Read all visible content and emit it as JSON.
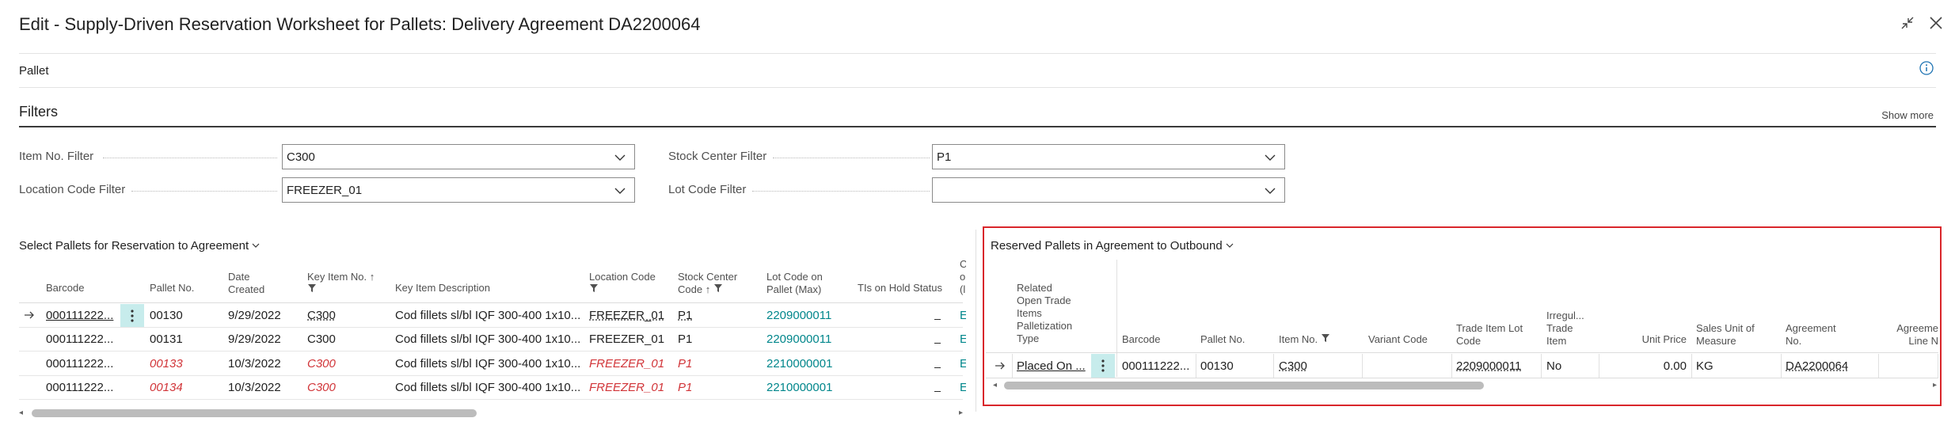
{
  "window": {
    "title": "Edit - Supply-Driven Reservation Worksheet for Pallets: Delivery Agreement DA2200064"
  },
  "page": {
    "subtitle": "Pallet"
  },
  "filters": {
    "title": "Filters",
    "show_more": "Show more",
    "item_no": {
      "label": "Item No. Filter",
      "value": "C300"
    },
    "location_code": {
      "label": "Location Code Filter",
      "value": "FREEZER_01"
    },
    "stock_center": {
      "label": "Stock Center Filter",
      "value": "P1"
    },
    "lot_code": {
      "label": "Lot Code Filter",
      "value": ""
    }
  },
  "select_part": {
    "title": "Select Pallets for Reservation to Agreement",
    "headers": {
      "barcode": "Barcode",
      "pallet_no": "Pallet No.",
      "date_created_1": "Date",
      "date_created_2": "Created",
      "key_item_no": "Key Item No.",
      "key_item_desc": "Key Item Description",
      "location_code": "Location Code",
      "stock_center_1": "Stock Center",
      "stock_center_2": "Code",
      "lot_code_1": "Lot Code on",
      "lot_code_2": "Pallet (Max)",
      "tis_on_hold": "TIs on Hold Status",
      "cut_1": "C",
      "cut_2": "o",
      "cut_3": "(l"
    },
    "rows": [
      {
        "barcode": "000111222...",
        "pallet_no": "00130",
        "date": "9/29/2022",
        "item": "C300",
        "desc": "Cod fillets sl/bl IQF 300-400 1x10...",
        "location": "FREEZER_01",
        "stock": "P1",
        "lot": "2209000011",
        "on_hold": "_",
        "extra": "E"
      },
      {
        "barcode": "000111222...",
        "pallet_no": "00131",
        "date": "9/29/2022",
        "item": "C300",
        "desc": "Cod fillets sl/bl IQF 300-400 1x10...",
        "location": "FREEZER_01",
        "stock": "P1",
        "lot": "2209000011",
        "on_hold": "_",
        "extra": "E"
      },
      {
        "barcode": "000111222...",
        "pallet_no": "00133",
        "date": "10/3/2022",
        "item": "C300",
        "desc": "Cod fillets sl/bl IQF 300-400 1x10...",
        "location": "FREEZER_01",
        "stock": "P1",
        "lot": "2210000001",
        "on_hold": "_",
        "extra": "E"
      },
      {
        "barcode": "000111222...",
        "pallet_no": "00134",
        "date": "10/3/2022",
        "item": "C300",
        "desc": "Cod fillets sl/bl IQF 300-400 1x10...",
        "location": "FREEZER_01",
        "stock": "P1",
        "lot": "2210000001",
        "on_hold": "_",
        "extra": "E"
      }
    ]
  },
  "reserved_part": {
    "title": "Reserved Pallets in Agreement to Outbound",
    "headers": {
      "rel_1": "Related",
      "rel_2": "Open Trade",
      "rel_3": "Items",
      "rel_4": "Palletization",
      "rel_5": "Type",
      "barcode": "Barcode",
      "pallet_no": "Pallet No.",
      "item_no": "Item No.",
      "variant_code": "Variant Code",
      "lot_1": "Trade Item Lot",
      "lot_2": "Code",
      "irr_1": "Irregul...",
      "irr_2": "Trade",
      "irr_3": "Item",
      "unit_price": "Unit Price",
      "sales_unit_1": "Sales Unit of",
      "sales_unit_2": "Measure",
      "agreement_1": "Agreement",
      "agreement_2": "No.",
      "line_1": "Agreeme",
      "line_2": "Line N"
    },
    "row": {
      "type": "Placed On ...",
      "barcode": "000111222...",
      "pallet_no": "00130",
      "item_no": "C300",
      "variant_code": "",
      "lot": "2209000011",
      "irregular": "No",
      "unit_price": "0.00",
      "sales_unit": "KG",
      "agreement": "DA2200064"
    }
  },
  "colors": {
    "accent_teal": "#00868b",
    "highlight_red": "#d9262b",
    "warning_text": "#d13438",
    "kebab_bg": "#c7ecec"
  }
}
